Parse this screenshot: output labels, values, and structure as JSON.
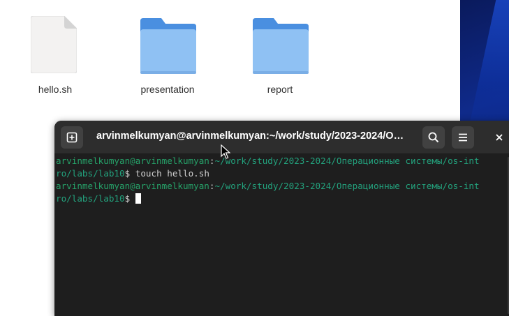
{
  "files": [
    {
      "name": "hello.sh",
      "icon": "text-file-icon"
    },
    {
      "name": "presentation",
      "icon": "folder-icon"
    },
    {
      "name": "report",
      "icon": "folder-icon"
    }
  ],
  "terminal": {
    "title": "arvinmelkumyan@arvinmelkumyan:~/work/study/2023-2024/О…",
    "lines": [
      {
        "user": "arvinmelkumyan@arvinmelkumyan",
        "sep": ":",
        "path": "~/work/study/2023-2024/Операционные системы/os-int",
        "path_cont": "ro/labs/lab10",
        "prompt": "$ ",
        "command": "touch hello.sh"
      },
      {
        "user": "arvinmelkumyan@arvinmelkumyan",
        "sep": ":",
        "path": "~/work/study/2023-2024/Операционные системы/os-int",
        "path_cont": "ro/labs/lab10",
        "prompt": "$ ",
        "command": ""
      }
    ]
  },
  "colors": {
    "folder_body": "#8fc1f3",
    "folder_tab": "#4a8fe0",
    "terminal_bg": "#1e1e1e",
    "terminal_header": "#2d2d2d",
    "prompt_user": "#26a269",
    "prompt_path": "#23a27d"
  }
}
